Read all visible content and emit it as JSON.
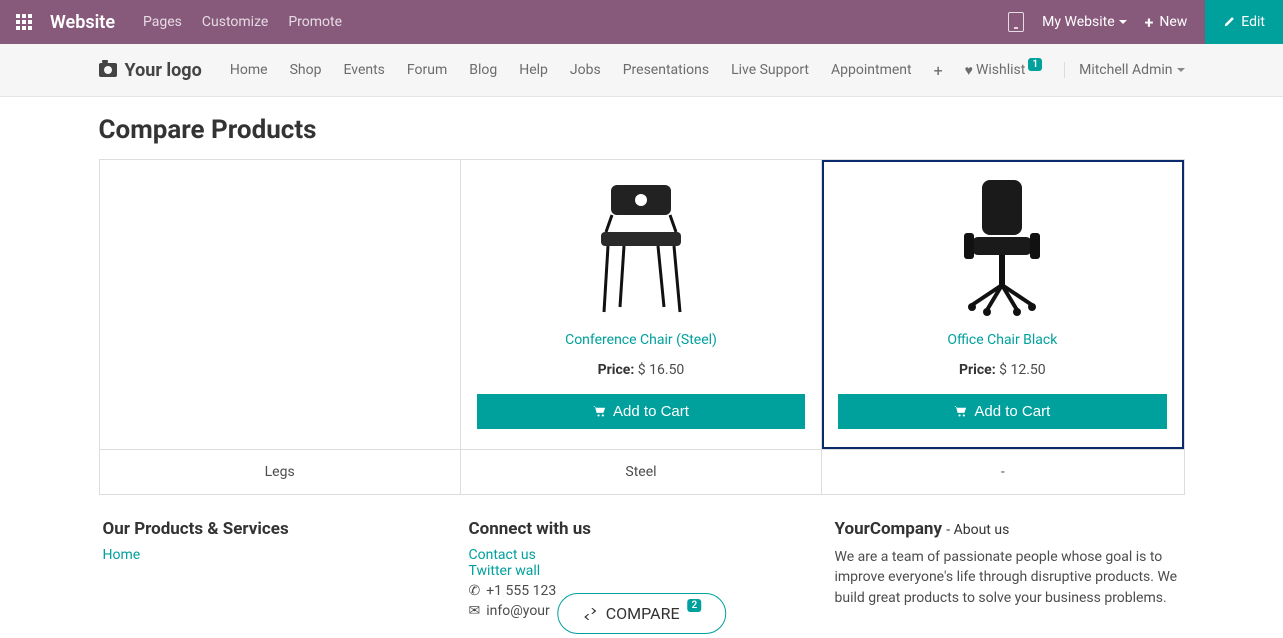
{
  "topbar": {
    "brand": "Website",
    "menu": [
      "Pages",
      "Customize",
      "Promote"
    ],
    "my_website": "My Website",
    "new": "New",
    "edit": "Edit"
  },
  "nav": {
    "logo_text": "Your logo",
    "links": [
      "Home",
      "Shop",
      "Events",
      "Forum",
      "Blog",
      "Help",
      "Jobs",
      "Presentations",
      "Live Support",
      "Appointment"
    ],
    "wishlist_label": "Wishlist",
    "wishlist_count": "1",
    "user": "Mitchell Admin"
  },
  "page": {
    "title": "Compare Products"
  },
  "compare": {
    "attr_label_0": "Legs",
    "products": [
      {
        "name": "Conference Chair (Steel)",
        "price_label": "Price:",
        "price": "$ 16.50",
        "add_label": "Add to Cart",
        "attr_0": "Steel"
      },
      {
        "name": "Office Chair Black",
        "price_label": "Price:",
        "price": "$ 12.50",
        "add_label": "Add to Cart",
        "attr_0": "-"
      }
    ]
  },
  "footer": {
    "col1": {
      "title": "Our Products & Services",
      "links": [
        "Home"
      ]
    },
    "col2": {
      "title": "Connect with us",
      "contact": "Contact us",
      "twitter": "Twitter wall",
      "phone": "+1 555 123",
      "email": "info@your"
    },
    "col3": {
      "company": "YourCompany",
      "dash": " - ",
      "about": "About us",
      "text": "We are a team of passionate people whose goal is to improve everyone's life through disruptive products. We build great products to solve your business problems."
    }
  },
  "compare_pill": {
    "label": "COMPARE",
    "count": "2"
  }
}
